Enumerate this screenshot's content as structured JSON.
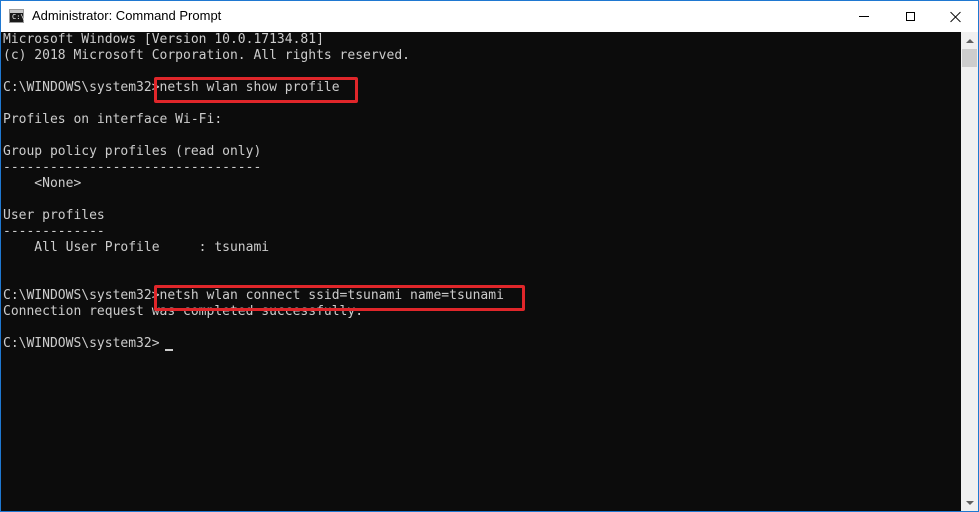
{
  "window": {
    "title": "Administrator: Command Prompt",
    "icon_name": "cmd-icon",
    "icon_label": "C:\\"
  },
  "controls": {
    "minimize": "minimize-icon",
    "maximize": "maximize-icon",
    "close": "close-icon"
  },
  "console": {
    "lines": [
      "Microsoft Windows [Version 10.0.17134.81]",
      "(c) 2018 Microsoft Corporation. All rights reserved.",
      "",
      "C:\\WINDOWS\\system32>netsh wlan show profile",
      "",
      "Profiles on interface Wi-Fi:",
      "",
      "Group policy profiles (read only)",
      "---------------------------------",
      "    <None>",
      "",
      "User profiles",
      "-------------",
      "    All User Profile     : tsunami",
      "",
      "",
      "C:\\WINDOWS\\system32>netsh wlan connect ssid=tsunami name=tsunami",
      "Connection request was completed successfully.",
      "",
      "C:\\WINDOWS\\system32>"
    ]
  },
  "colors": {
    "background": "#0c0c0c",
    "text": "#cccccc",
    "highlight": "#e0262a"
  }
}
